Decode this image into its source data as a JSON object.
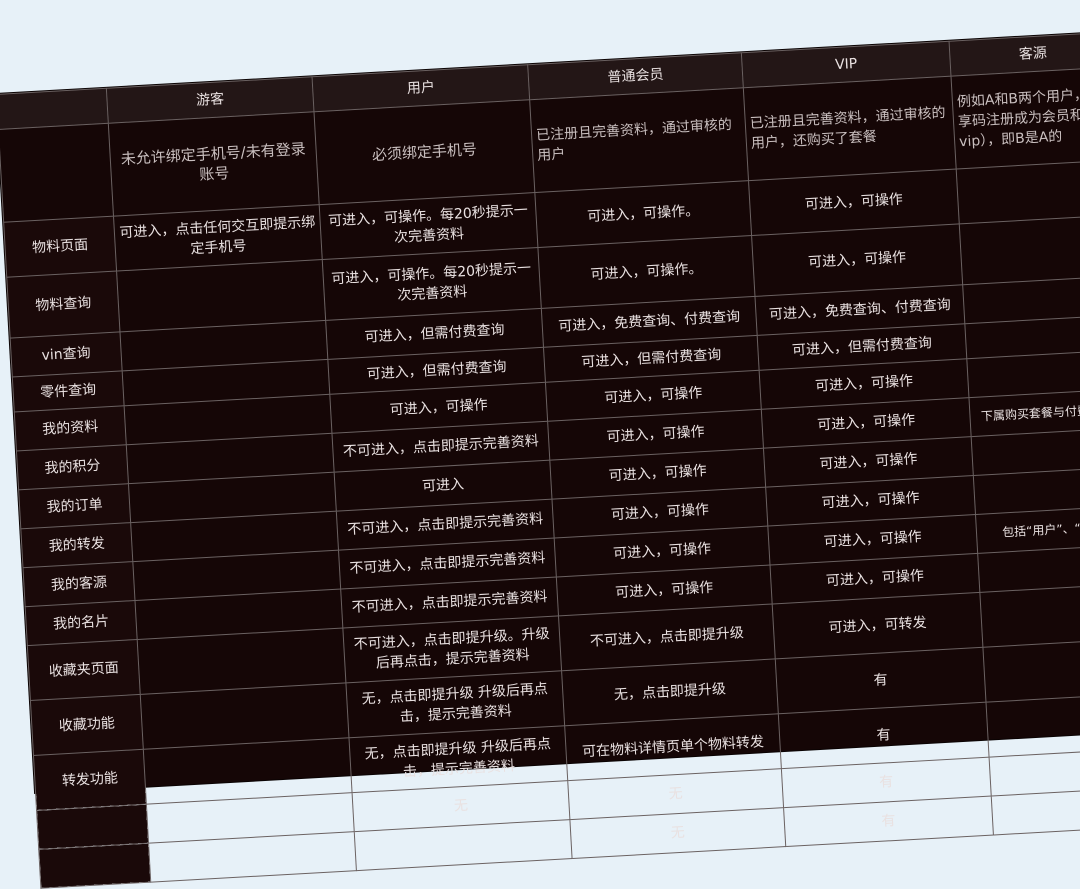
{
  "table": {
    "headers": [
      "",
      "游客",
      "用户",
      "普通会员",
      "VIP",
      "客源"
    ],
    "descriptions": [
      "",
      "未允许绑定手机号/未有登录账号",
      "必须绑定手机号",
      "已注册且完善资料，通过审核的用户",
      "已注册且完善资料，通过审核的用户，还购买了套餐",
      "例如A和B两个用户，分享码注册成为会员和vip），即B是A的"
    ],
    "rows": [
      {
        "name": "物料页面",
        "cells": [
          "可进入，点击任何交互即提示绑定手机号",
          "可进入，可操作。每20秒提示一次完善资料",
          "可进入，可操作。",
          "可进入，可操作",
          ""
        ]
      },
      {
        "name": "物料查询",
        "cells": [
          "",
          "可进入，可操作。每20秒提示一次完善资料",
          "可进入，可操作。",
          "可进入，可操作",
          ""
        ]
      },
      {
        "name": "vin查询",
        "cells": [
          "",
          "可进入，但需付费查询",
          "可进入，免费查询、付费查询",
          "可进入，免费查询、付费查询",
          ""
        ]
      },
      {
        "name": "零件查询",
        "cells": [
          "",
          "可进入，但需付费查询",
          "可进入，但需付费查询",
          "可进入，但需付费查询",
          ""
        ]
      },
      {
        "name": "我的资料",
        "cells": [
          "",
          "可进入，可操作",
          "可进入，可操作",
          "可进入，可操作",
          ""
        ]
      },
      {
        "name": "我的积分",
        "cells": [
          "",
          "不可进入，点击即提示完善资料",
          "可进入，可操作",
          "可进入，可操作",
          "下属购买套餐与付费得积分"
        ]
      },
      {
        "name": "我的订单",
        "cells": [
          "",
          "可进入",
          "可进入，可操作",
          "可进入，可操作",
          ""
        ]
      },
      {
        "name": "我的转发",
        "cells": [
          "",
          "不可进入，点击即提示完善资料",
          "可进入，可操作",
          "可进入，可操作",
          ""
        ]
      },
      {
        "name": "我的客源",
        "cells": [
          "",
          "不可进入，点击即提示完善资料",
          "可进入，可操作",
          "可进入，可操作",
          "包括“用户”、“普通会"
        ]
      },
      {
        "name": "我的名片",
        "cells": [
          "",
          "不可进入，点击即提示完善资料",
          "可进入，可操作",
          "可进入，可操作",
          ""
        ]
      },
      {
        "name": "收藏夹页面",
        "cells": [
          "",
          "不可进入，点击即提升级。升级后再点击，提示完善资料",
          "不可进入，点击即提升级",
          "可进入，可转发",
          ""
        ]
      },
      {
        "name": "收藏功能",
        "cells": [
          "",
          "无，点击即提升级 升级后再点击，提示完善资料",
          "无，点击即提升级",
          "有",
          ""
        ]
      },
      {
        "name": "转发功能",
        "cells": [
          "",
          "无，点击即提升级 升级后再点击，提示完善资料",
          "可在物料详情页单个物料转发",
          "有",
          ""
        ]
      },
      {
        "name": "",
        "cells": [
          "",
          "无",
          "无",
          "有",
          ""
        ]
      },
      {
        "name": "",
        "cells": [
          "",
          "",
          "无",
          "有",
          ""
        ]
      }
    ]
  }
}
